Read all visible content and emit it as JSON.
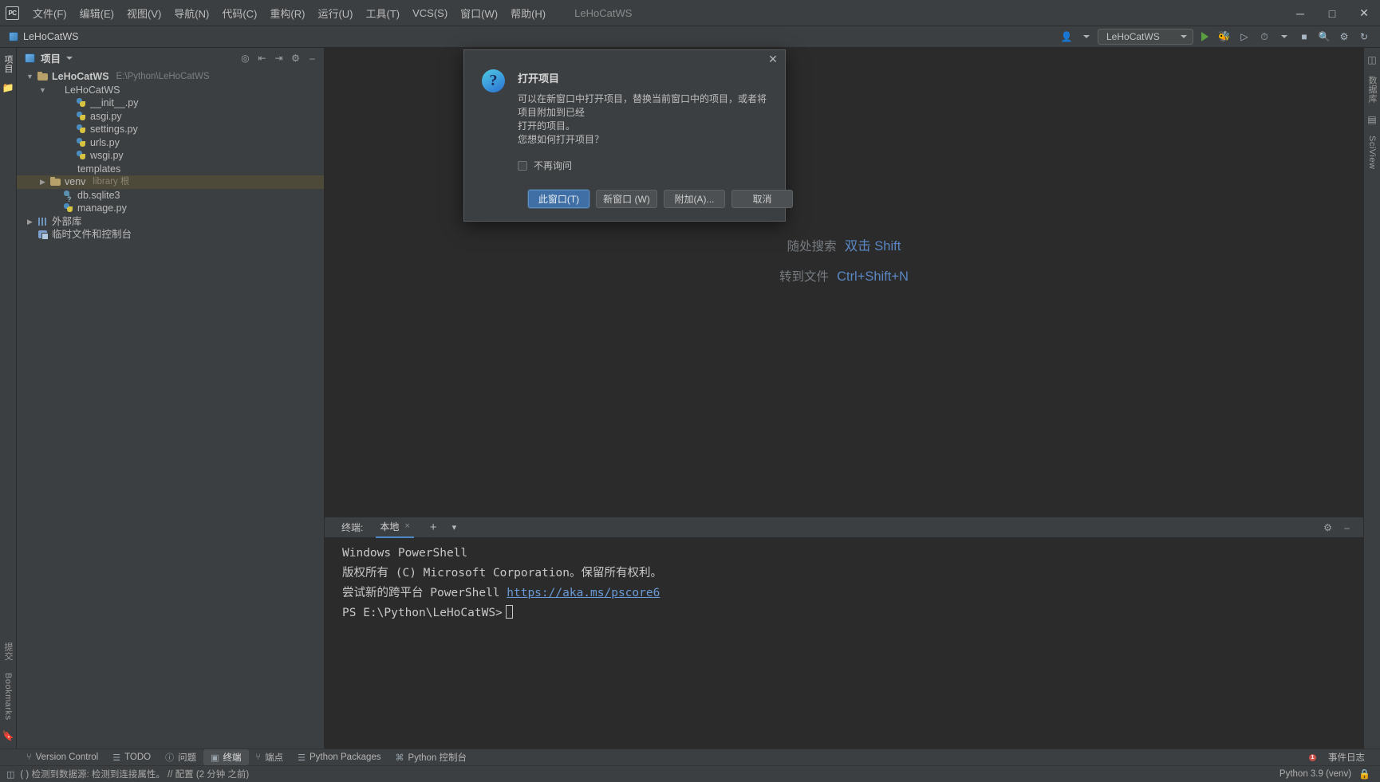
{
  "titlebar": {
    "logo": "PC",
    "menus": [
      {
        "label": "文件(F)",
        "name": "menu-file"
      },
      {
        "label": "编辑(E)",
        "name": "menu-edit"
      },
      {
        "label": "视图(V)",
        "name": "menu-view"
      },
      {
        "label": "导航(N)",
        "name": "menu-navigate"
      },
      {
        "label": "代码(C)",
        "name": "menu-code"
      },
      {
        "label": "重构(R)",
        "name": "menu-refactor"
      },
      {
        "label": "运行(U)",
        "name": "menu-run"
      },
      {
        "label": "工具(T)",
        "name": "menu-tools"
      },
      {
        "label": "VCS(S)",
        "name": "menu-vcs"
      },
      {
        "label": "窗口(W)",
        "name": "menu-window"
      },
      {
        "label": "帮助(H)",
        "name": "menu-help"
      }
    ],
    "window_title": "LeHoCatWS",
    "minimize": "─",
    "maximize": "□",
    "close": "✕"
  },
  "navbar": {
    "project_label": "LeHoCatWS",
    "run_config": "LeHoCatWS",
    "run_icon": "run-icon",
    "debug_icon": "debug-icon",
    "coverage_icon": "coverage-icon",
    "profile_icon": "profile-icon",
    "stop_icon": "stop-icon",
    "search_icon": "search-icon",
    "settings_icon": "settings-icon",
    "account_icon": "account-icon",
    "updates_icon": "updates-icon"
  },
  "left_strip": {
    "project_label": "项目",
    "structure_icon": "structure-icon",
    "commit_label": "提交",
    "bookmarks_label": "Bookmarks"
  },
  "right_strip": {
    "database_label": "数据库",
    "sciview_label": "SciView"
  },
  "project_panel": {
    "title": "项目",
    "dropdown_icon": "chevron-down-icon",
    "locate_icon": "locate-icon",
    "expand_icon": "expand-all-icon",
    "collapse_icon": "collapse-all-icon",
    "settings_icon": "gear-icon",
    "hide_icon": "hide-icon",
    "tree": [
      {
        "label": "LeHoCatWS",
        "detail": "E:\\Python\\LeHoCatWS",
        "indent": 0,
        "arrow": "▼",
        "icon": "folder",
        "bold": true,
        "selected": false,
        "detail_kind": "path"
      },
      {
        "label": "LeHoCatWS",
        "detail": "",
        "indent": 1,
        "arrow": "▼",
        "icon": "folder-src",
        "bold": false,
        "selected": false,
        "detail_kind": ""
      },
      {
        "label": "__init__.py",
        "detail": "",
        "indent": 3,
        "arrow": "",
        "icon": "py",
        "bold": false,
        "selected": false,
        "detail_kind": ""
      },
      {
        "label": "asgi.py",
        "detail": "",
        "indent": 3,
        "arrow": "",
        "icon": "py",
        "bold": false,
        "selected": false,
        "detail_kind": ""
      },
      {
        "label": "settings.py",
        "detail": "",
        "indent": 3,
        "arrow": "",
        "icon": "py",
        "bold": false,
        "selected": false,
        "detail_kind": ""
      },
      {
        "label": "urls.py",
        "detail": "",
        "indent": 3,
        "arrow": "",
        "icon": "py",
        "bold": false,
        "selected": false,
        "detail_kind": ""
      },
      {
        "label": "wsgi.py",
        "detail": "",
        "indent": 3,
        "arrow": "",
        "icon": "py",
        "bold": false,
        "selected": false,
        "detail_kind": ""
      },
      {
        "label": "templates",
        "detail": "",
        "indent": 2,
        "arrow": "",
        "icon": "folder-tpl",
        "bold": false,
        "selected": false,
        "detail_kind": ""
      },
      {
        "label": "venv",
        "detail": "library 根",
        "indent": 1,
        "arrow": "▶",
        "icon": "folder",
        "bold": false,
        "selected": true,
        "detail_kind": "tag"
      },
      {
        "label": "db.sqlite3",
        "detail": "",
        "indent": 2,
        "arrow": "",
        "icon": "db",
        "bold": false,
        "selected": false,
        "detail_kind": ""
      },
      {
        "label": "manage.py",
        "detail": "",
        "indent": 2,
        "arrow": "",
        "icon": "py",
        "bold": false,
        "selected": false,
        "detail_kind": ""
      },
      {
        "label": "外部库",
        "detail": "",
        "indent": 0,
        "arrow": "▶",
        "icon": "lib",
        "bold": false,
        "selected": false,
        "detail_kind": ""
      },
      {
        "label": "临时文件和控制台",
        "detail": "",
        "indent": 0,
        "arrow": "",
        "icon": "scratch",
        "bold": false,
        "selected": false,
        "detail_kind": ""
      }
    ]
  },
  "editor": {
    "hints": [
      {
        "label": "随处搜索",
        "key": "双击 Shift"
      },
      {
        "label": "转到文件",
        "key": "Ctrl+Shift+N"
      }
    ]
  },
  "dialog": {
    "title": "打开项目",
    "close_icon": "close-icon",
    "question_icon": "question-icon",
    "glyph": "?",
    "message_lines": [
      "可以在新窗口中打开项目，替换当前窗口中的项目，或者将项目附加到已经",
      "打开的项目。",
      "您想如何打开项目？"
    ],
    "checkbox_label": "不再询问",
    "checkbox_checked": false,
    "buttons": [
      {
        "label": "此窗口(T)",
        "primary": true,
        "name": "this-window-button"
      },
      {
        "label": "新窗口 (W)",
        "primary": false,
        "name": "new-window-button"
      },
      {
        "label": "附加(A)...",
        "primary": false,
        "name": "attach-button"
      },
      {
        "label": "取消",
        "primary": false,
        "name": "cancel-button"
      }
    ]
  },
  "terminal": {
    "label": "终端:",
    "tab": "本地",
    "tab_close": "×",
    "add_icon": "+",
    "chevron_icon": "▾",
    "settings_icon": "gear-icon",
    "hide_icon": "hide-icon",
    "lines": [
      {
        "text": "Windows PowerShell",
        "link": ""
      },
      {
        "text": "版权所有 (C) Microsoft Corporation。保留所有权利。",
        "link": ""
      },
      {
        "text": "",
        "link": ""
      },
      {
        "text": "尝试新的跨平台 PowerShell ",
        "link": "https://aka.ms/pscore6"
      },
      {
        "text": "",
        "link": ""
      },
      {
        "text": "PS E:\\Python\\LeHoCatWS>",
        "link": "",
        "caret": true
      }
    ]
  },
  "toolwindow_bar": {
    "items": [
      {
        "label": "Version Control",
        "icon": "branch-icon",
        "active": false,
        "name": "toolwindow-version-control"
      },
      {
        "label": "TODO",
        "icon": "list-icon",
        "active": false,
        "name": "toolwindow-todo"
      },
      {
        "label": "问题",
        "icon": "warning-icon",
        "active": false,
        "name": "toolwindow-problems"
      },
      {
        "label": "终端",
        "icon": "terminal-icon",
        "active": true,
        "name": "toolwindow-terminal"
      },
      {
        "label": "端点",
        "icon": "endpoints-icon",
        "active": false,
        "name": "toolwindow-endpoints"
      },
      {
        "label": "Python Packages",
        "icon": "packages-icon",
        "active": false,
        "name": "toolwindow-python-packages"
      },
      {
        "label": "Python 控制台",
        "icon": "python-icon",
        "active": false,
        "name": "toolwindow-python-console"
      }
    ],
    "event_log_label": "事件日志",
    "event_badge": "1"
  },
  "statusbar": {
    "message": "( ) 检测到数据源: 检测到连接属性。 // 配置 (2 分钟 之前)",
    "interpreter": "Python 3.9 (venv)",
    "lock_icon": "lock-icon",
    "notification_icon": "notification-icon"
  }
}
